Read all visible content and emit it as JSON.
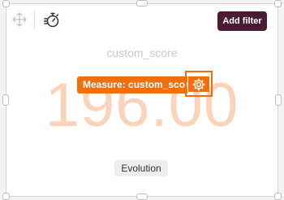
{
  "toolbar": {
    "move_icon": "move-arrows-icon",
    "timer_icon": "stopwatch-icon",
    "add_filter_label": "Add filter",
    "add_filter_color": "#4a1b32"
  },
  "kpi": {
    "title": "custom_score",
    "value": "196.00",
    "value_color": "#fbd3b9"
  },
  "measure": {
    "label": "Measure: custom_score",
    "accent": "#f06f0c",
    "settings_icon": "gear-icon"
  },
  "footer": {
    "evolution_label": "Evolution"
  }
}
